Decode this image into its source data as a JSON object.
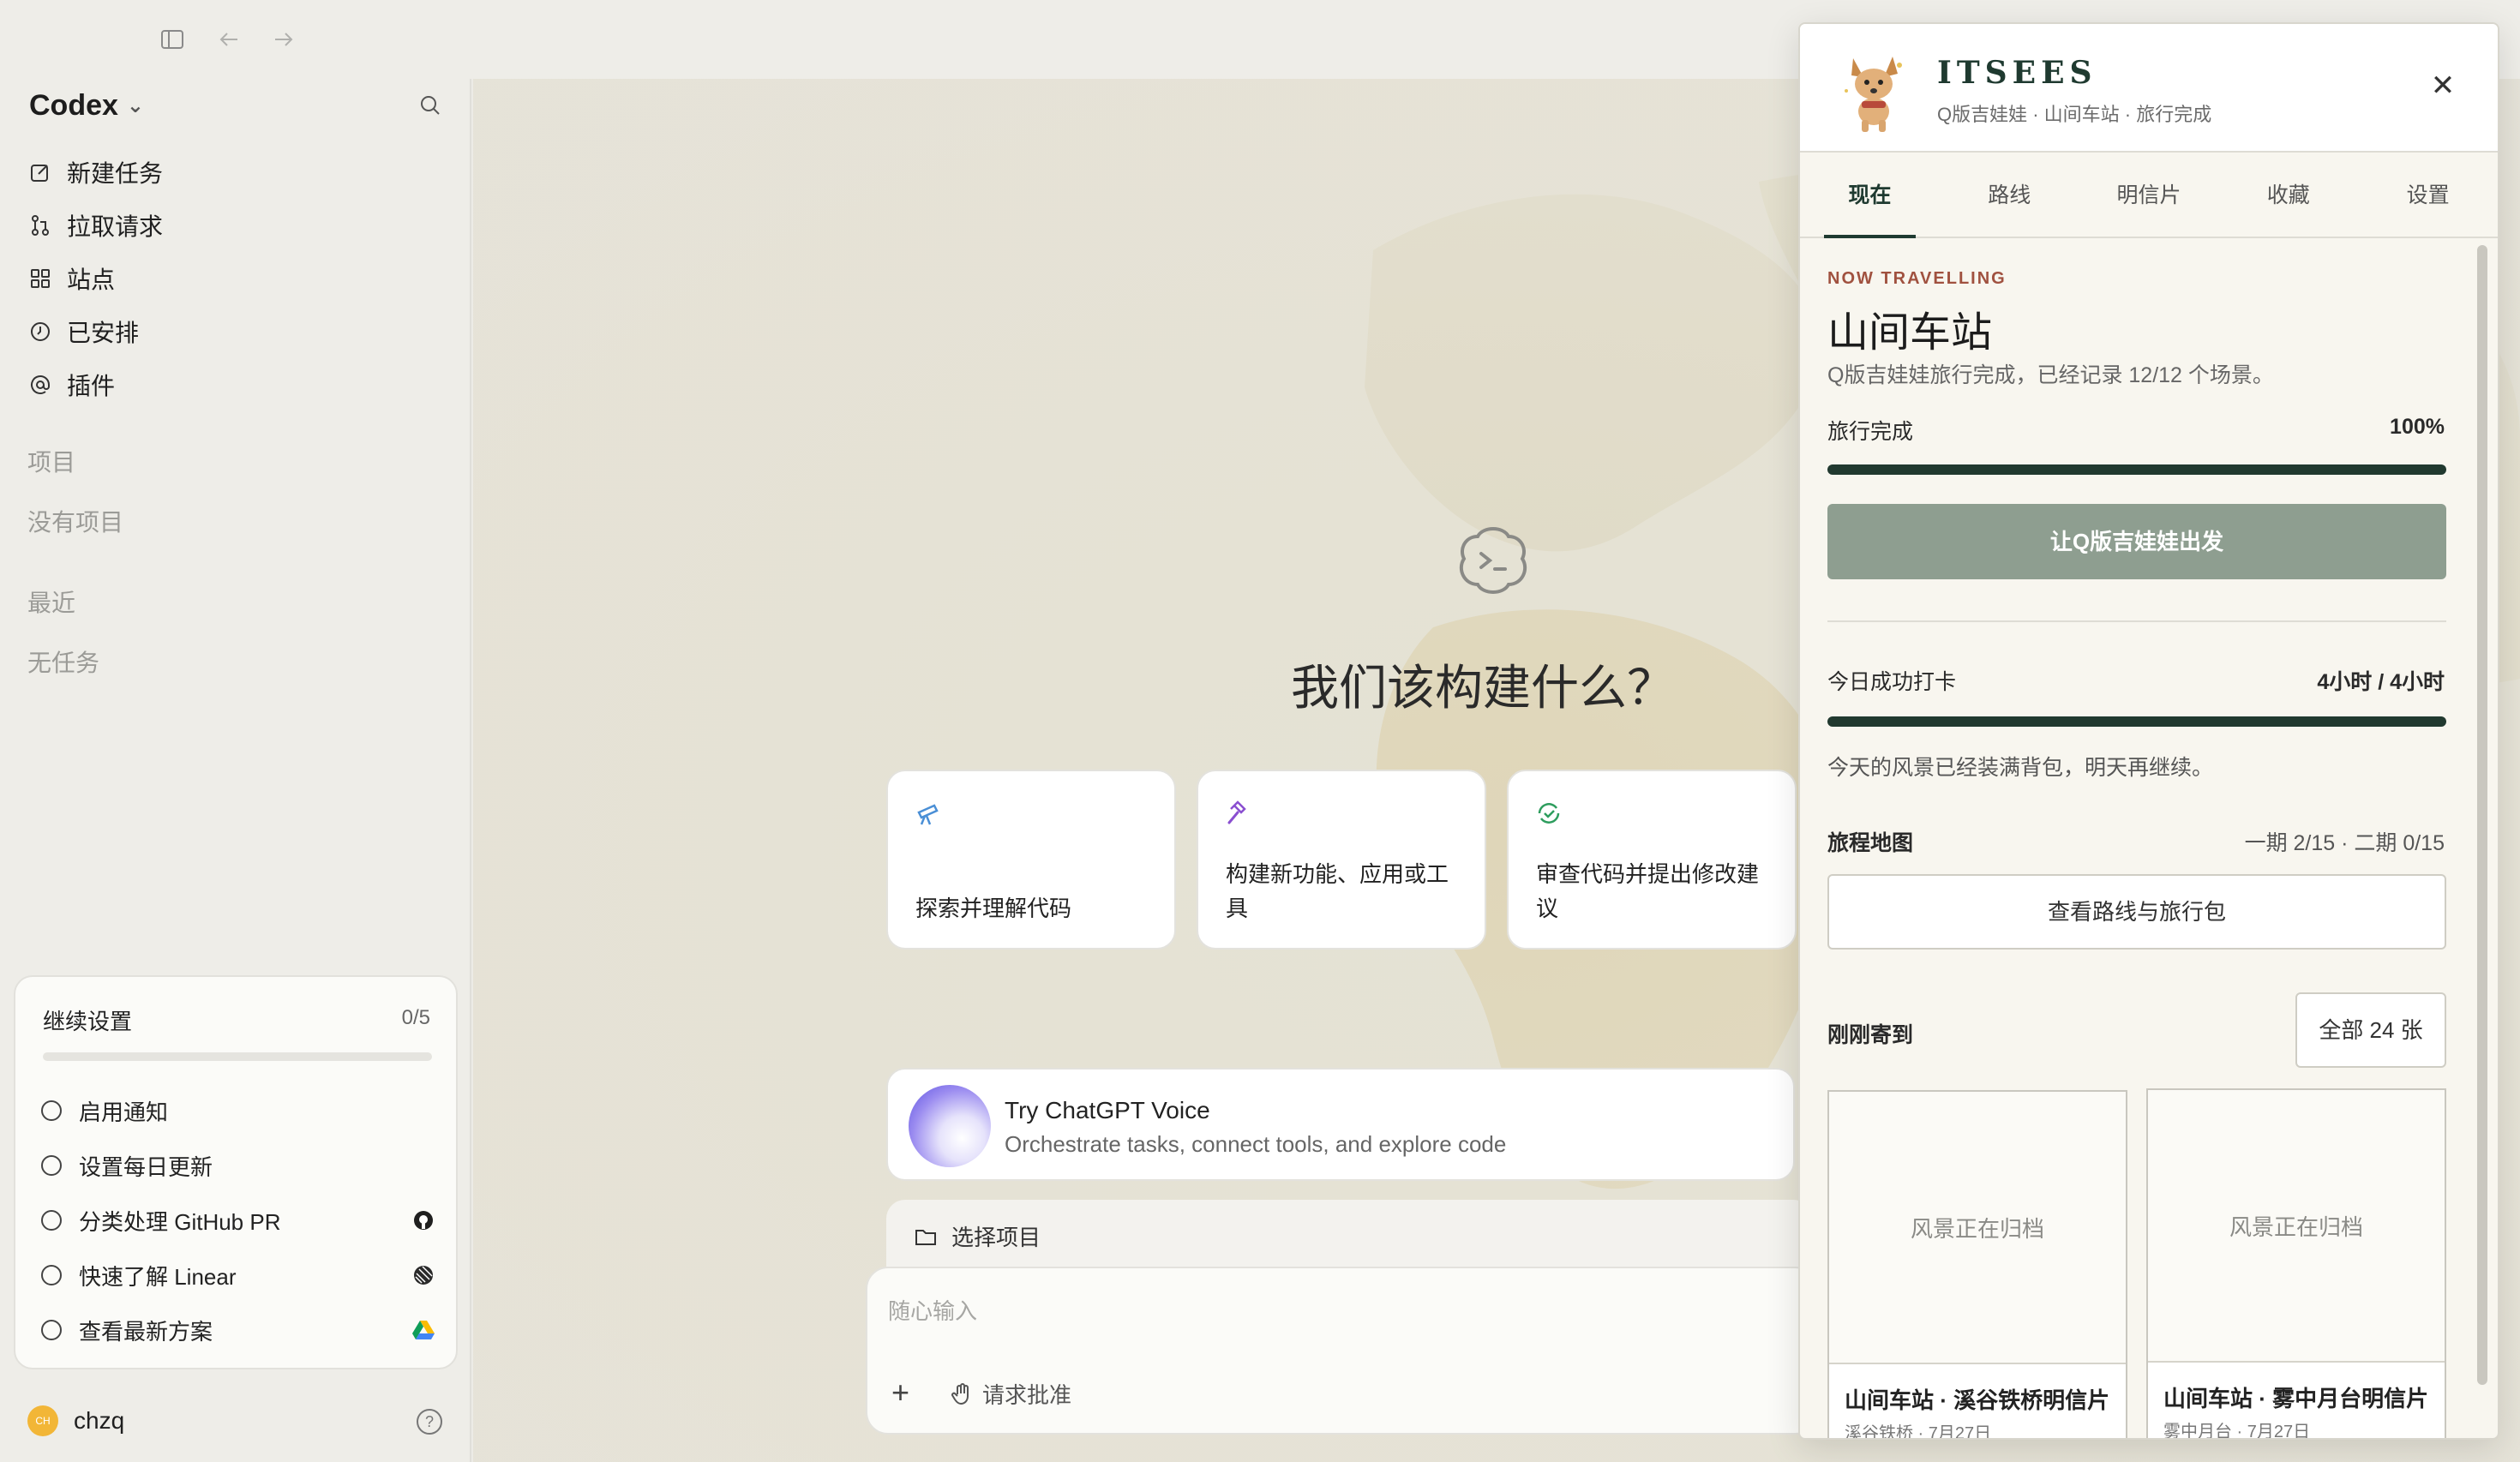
{
  "titlebar": {
    "icons": [
      "sidebar-toggle-icon",
      "back-arrow-icon",
      "forward-arrow-icon"
    ]
  },
  "sidebar": {
    "brand": "Codex",
    "nav": [
      {
        "label": "新建任务",
        "icon": "new-task-icon"
      },
      {
        "label": "拉取请求",
        "icon": "pull-request-icon"
      },
      {
        "label": "站点",
        "icon": "sites-grid-icon"
      },
      {
        "label": "已安排",
        "icon": "clock-icon"
      },
      {
        "label": "插件",
        "icon": "at-sign-icon"
      }
    ],
    "projects_heading": "项目",
    "projects_empty": "没有项目",
    "recent_heading": "最近",
    "recent_empty": "无任务",
    "setup": {
      "title": "继续设置",
      "count": "0/5",
      "progress": 0,
      "items": [
        {
          "label": "启用通知",
          "icon": ""
        },
        {
          "label": "设置每日更新",
          "icon": ""
        },
        {
          "label": "分类处理 GitHub PR",
          "icon": "github-icon"
        },
        {
          "label": "快速了解 Linear",
          "icon": "linear-icon"
        },
        {
          "label": "查看最新方案",
          "icon": "drive-icon"
        }
      ]
    },
    "user": {
      "avatar": "CH",
      "name": "chzq"
    }
  },
  "main": {
    "headline": "我们该构建什么？",
    "cards": [
      {
        "label": "探索并理解代码",
        "icon": "telescope-icon"
      },
      {
        "label": "构建新功能、应用或工具",
        "icon": "hammer-icon"
      },
      {
        "label": "审查代码并提出修改建议",
        "icon": "review-icon"
      }
    ],
    "voice": {
      "title": "Try ChatGPT Voice",
      "subtitle": "Orchestrate tasks, connect tools, and explore code"
    },
    "project_select": "选择项目",
    "composer": {
      "placeholder": "随心输入",
      "approval": "请求批准"
    }
  },
  "panel": {
    "title": "ITSEES",
    "subtitle": "Q版吉娃娃 · 山间车站 · 旅行完成",
    "tabs": [
      "现在",
      "路线",
      "明信片",
      "收藏",
      "设置"
    ],
    "active_tab": 0,
    "kicker": "NOW TRAVELLING",
    "place": "山间车站",
    "place_desc": "Q版吉娃娃旅行完成，已经记录 12/12 个场景。",
    "travel_label": "旅行完成",
    "travel_value": "100%",
    "travel_progress": 1.0,
    "go_button": "让Q版吉娃娃出发",
    "checkin_label": "今日成功打卡",
    "checkin_value": "4小时 / 4小时",
    "checkin_progress": 1.0,
    "checkin_note": "今天的风景已经装满背包，明天再继续。",
    "map_label": "旅程地图",
    "map_value": "一期 2/15 · 二期 0/15",
    "route_button": "查看路线与旅行包",
    "recent_label": "刚刚寄到",
    "all_button": "全部 24 张",
    "postcards": [
      {
        "placeholder": "风景正在归档",
        "title": "山间车站 · 溪谷铁桥明信片",
        "meta": "溪谷铁桥 · 7月27日"
      },
      {
        "placeholder": "风景正在归档",
        "title": "山间车站 · 雾中月台明信片",
        "meta": "雾中月台 · 7月27日"
      }
    ]
  },
  "colors": {
    "accent_green": "#21392f",
    "kicker_red": "#a0513f",
    "button_sage": "#8e9e90"
  }
}
